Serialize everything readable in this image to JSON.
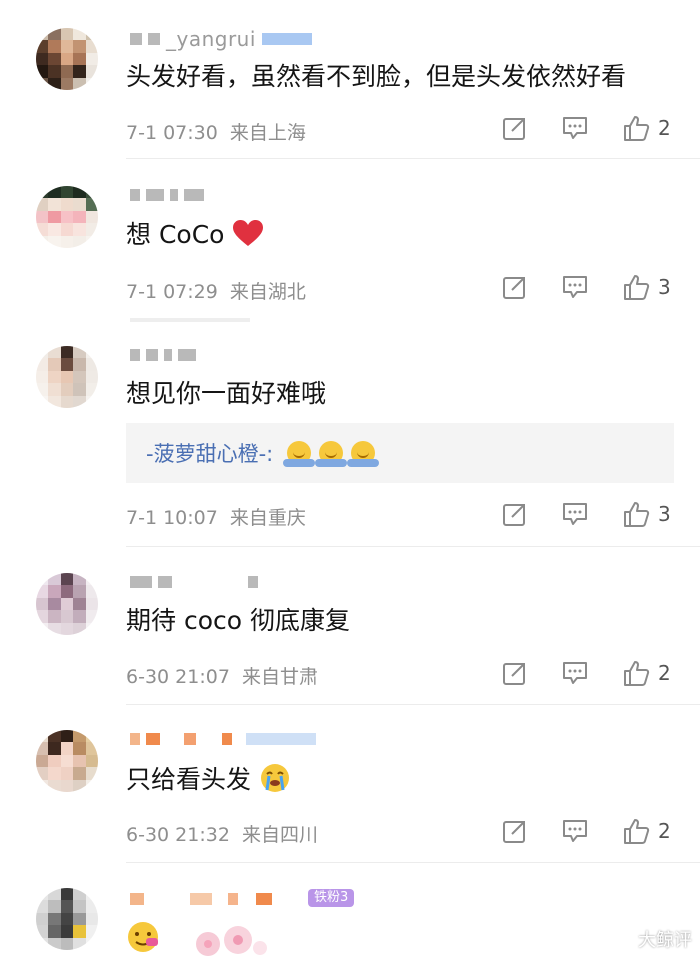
{
  "comments": [
    {
      "username_partial": "_yangrui",
      "text": "头发好看，虽然看不到脸，但是头发依然好看",
      "time": "7-1 07:30",
      "location": "来自上海",
      "likes": "2"
    },
    {
      "username_partial": "",
      "text": "想 CoCo",
      "time": "7-1 07:29",
      "location": "来自湖北",
      "likes": "3"
    },
    {
      "username_partial": "",
      "text": "想见你一面好难哦",
      "reply_author": "-菠萝甜心橙-:",
      "time": "7-1 10:07",
      "location": "来自重庆",
      "likes": "3"
    },
    {
      "username_partial": "",
      "text": "期待 coco 彻底康复",
      "time": "6-30 21:07",
      "location": "来自甘肃",
      "likes": "2"
    },
    {
      "username_partial": "",
      "text": "只给看头发",
      "time": "6-30 21:32",
      "location": "来自四川",
      "likes": "2"
    },
    {
      "username_partial": "",
      "badge": "铁粉3",
      "text": "",
      "time": "",
      "location": "",
      "likes": ""
    }
  ],
  "watermark": "大鲸评",
  "icons": {
    "share": "share-icon",
    "comment": "comment-icon",
    "like": "thumbs-up-icon",
    "heart": "heart-icon"
  },
  "colors": {
    "link": "#4a6fb3",
    "meta": "#8e8e8e",
    "heart": "#e0313f"
  }
}
